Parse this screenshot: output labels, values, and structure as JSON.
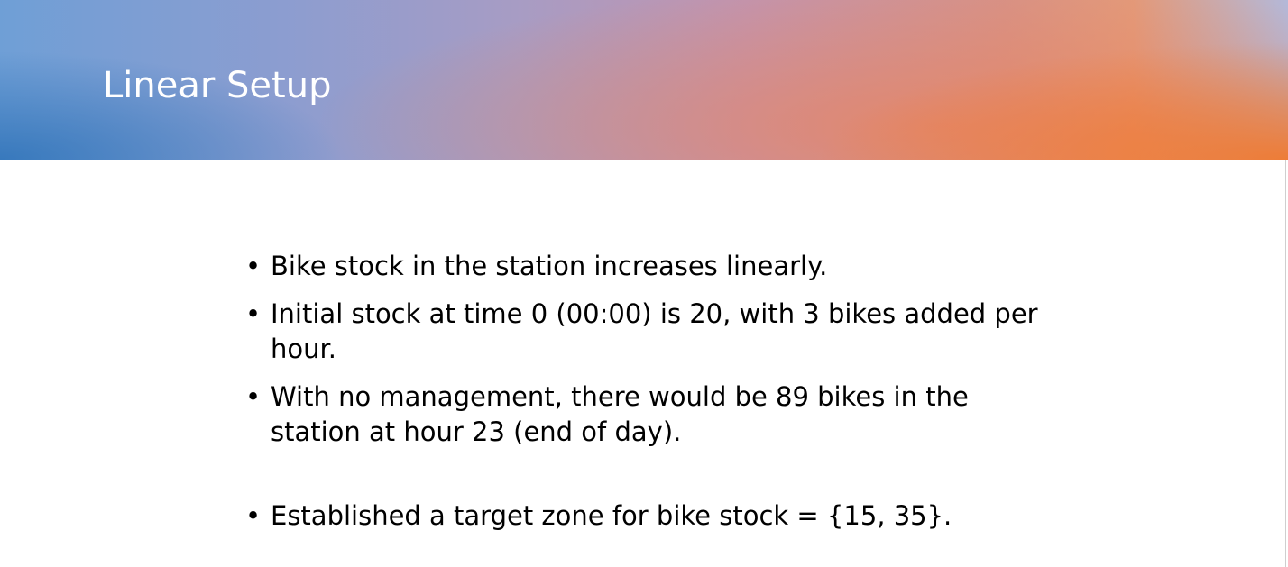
{
  "slide": {
    "title": "Linear Setup",
    "colors": {
      "header_left": "#2e72b8",
      "header_mid": "#b497b8",
      "header_right": "#f07a30",
      "body_background": "#ffffff",
      "text": "#000000"
    },
    "bullet_glyph": "•",
    "bullets": [
      "Bike stock in the station increases linearly.",
      "Initial stock at time 0 (00:00) is 20, with 3 bikes added per hour.",
      "With no management, there would be 89 bikes in the station at hour 23 (end of day).",
      "Established a target zone for bike stock = {15, 35}."
    ]
  }
}
